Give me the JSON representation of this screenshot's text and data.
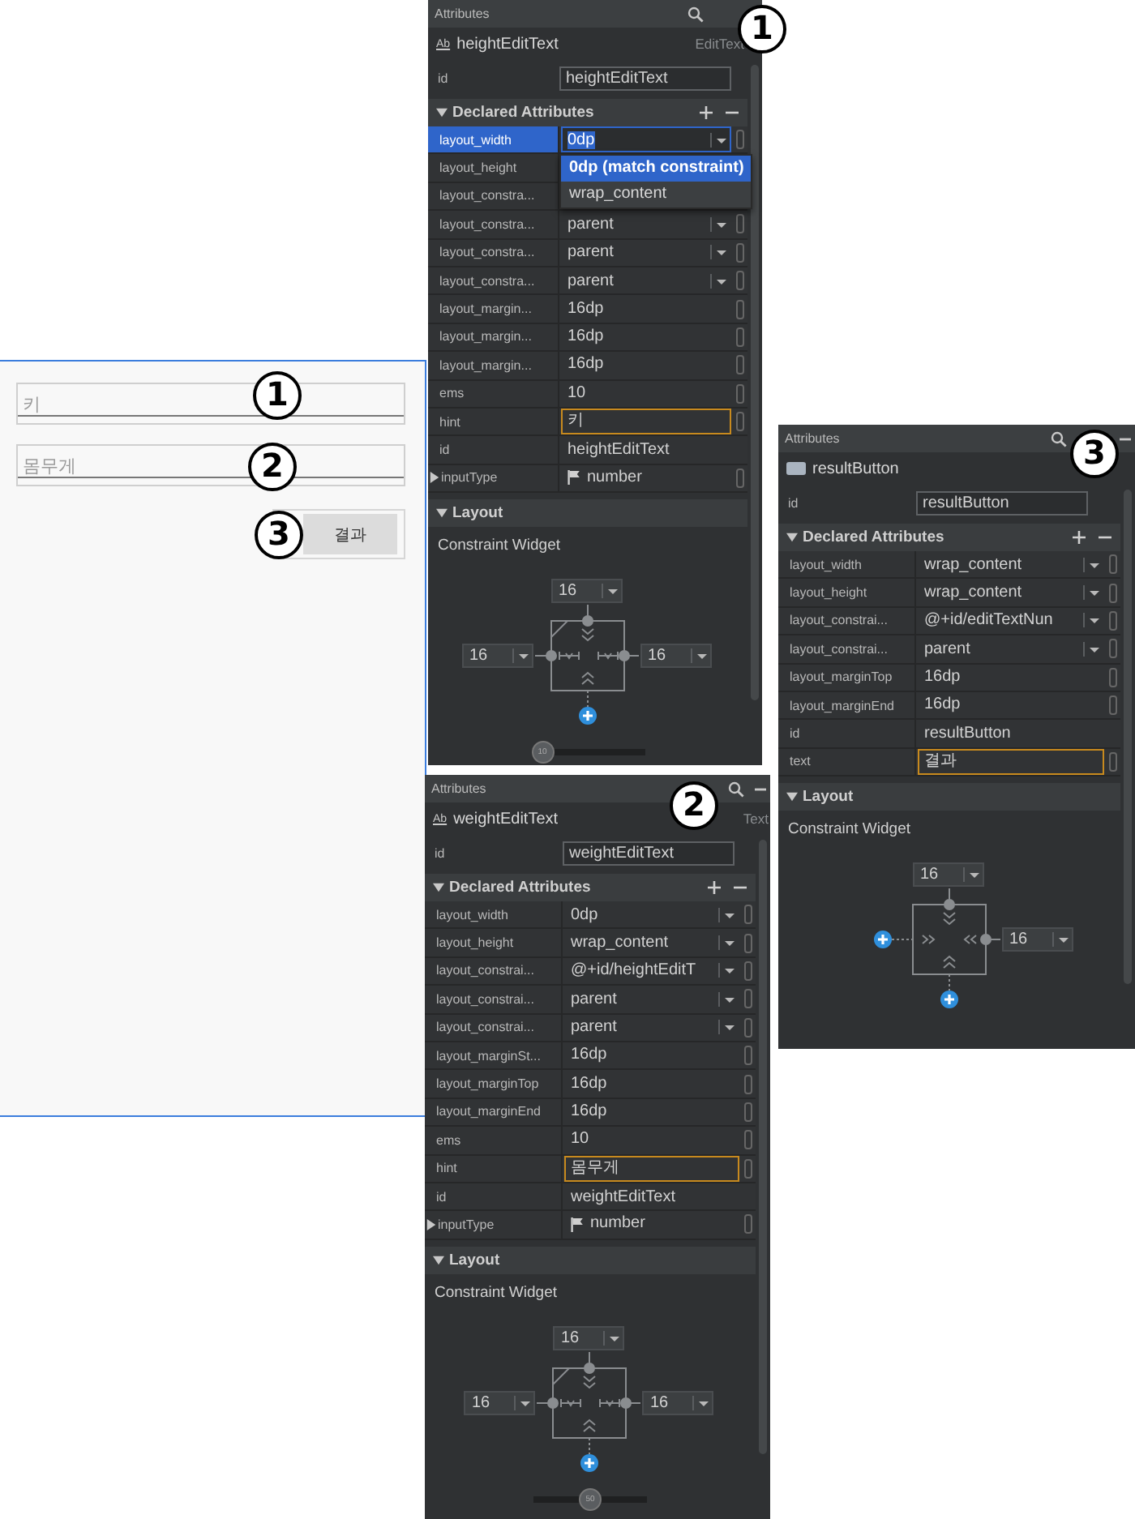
{
  "preview": {
    "fields": [
      {
        "hint": "키",
        "marker": "1"
      },
      {
        "hint": "몸무게",
        "marker": "2"
      }
    ],
    "button": {
      "label": "결과",
      "marker": "3"
    }
  },
  "panels": [
    {
      "title": "Attributes",
      "tools": [
        {
          "kind": "search"
        }
      ],
      "marker": "1",
      "component": {
        "icon": {
          "kind": "text",
          "label": "Ab"
        },
        "name": "heightEditText",
        "type": "EditText"
      },
      "id_field": {
        "label": "id",
        "value": "heightEditText"
      },
      "declared": {
        "title": "Declared Attributes",
        "expanded": true,
        "rows": [
          {
            "label": "layout_width",
            "value": "0dp",
            "kind": "dropdown",
            "selected": true,
            "options": [
              {
                "label": "0dp (match constraint)",
                "selected": true
              },
              {
                "label": "wrap_content",
                "selected": false
              }
            ]
          },
          {
            "label": "layout_height",
            "kind": "covered",
            "selected": false
          },
          {
            "label": "layout_constra...",
            "kind": "covered",
            "selected": false
          },
          {
            "label": "layout_constra...",
            "value": "parent",
            "kind": "dropdown",
            "selected": false
          },
          {
            "label": "layout_constra...",
            "value": "parent",
            "kind": "dropdown",
            "selected": false
          },
          {
            "label": "layout_constra...",
            "value": "parent",
            "kind": "dropdown",
            "selected": false
          },
          {
            "label": "layout_margin...",
            "value": "16dp",
            "kind": "text",
            "selected": false,
            "focused": false
          },
          {
            "label": "layout_margin...",
            "value": "16dp",
            "kind": "text",
            "selected": false,
            "focused": false
          },
          {
            "label": "layout_margin...",
            "value": "16dp",
            "kind": "text",
            "selected": false,
            "focused": false
          },
          {
            "label": "ems",
            "value": "10",
            "kind": "text",
            "selected": false,
            "focused": false
          },
          {
            "label": "hint",
            "value": "키",
            "kind": "text",
            "selected": false,
            "focused": true
          },
          {
            "label": "id",
            "value": "heightEditText",
            "kind": "plain",
            "selected": false
          },
          {
            "label": "inputType",
            "value": "number",
            "kind": "flag",
            "selected": false,
            "expanded": false
          }
        ]
      },
      "layout": {
        "title": "Layout",
        "expanded": true,
        "subtitle": "Constraint Widget",
        "widget": {
          "kind": "match",
          "top": {
            "kind": "value",
            "value": "16"
          },
          "left": {
            "kind": "value",
            "value": "16"
          },
          "right": {
            "kind": "value",
            "value": "16"
          },
          "bottom": {
            "kind": "add"
          }
        },
        "bias": {
          "level": 0.1,
          "label": "10"
        }
      }
    },
    {
      "title": "Attributes",
      "tools": [
        {
          "kind": "search"
        },
        {
          "kind": "minimize"
        }
      ],
      "marker": "2",
      "component": {
        "icon": {
          "kind": "text",
          "label": "Ab"
        },
        "name": "weightEditText",
        "type": "Text"
      },
      "id_field": {
        "label": "id",
        "value": "weightEditText"
      },
      "declared": {
        "title": "Declared Attributes",
        "expanded": true,
        "rows": [
          {
            "label": "layout_width",
            "value": "0dp",
            "kind": "dropdown",
            "selected": false
          },
          {
            "label": "layout_height",
            "value": "wrap_content",
            "kind": "dropdown",
            "selected": false
          },
          {
            "label": "layout_constrai...",
            "value": "@+id/heightEditT",
            "kind": "dropdown",
            "selected": false
          },
          {
            "label": "layout_constrai...",
            "value": "parent",
            "kind": "dropdown",
            "selected": false
          },
          {
            "label": "layout_constrai...",
            "value": "parent",
            "kind": "dropdown",
            "selected": false
          },
          {
            "label": "layout_marginSt...",
            "value": "16dp",
            "kind": "text",
            "selected": false,
            "focused": false
          },
          {
            "label": "layout_marginTop",
            "value": "16dp",
            "kind": "text",
            "selected": false,
            "focused": false
          },
          {
            "label": "layout_marginEnd",
            "value": "16dp",
            "kind": "text",
            "selected": false,
            "focused": false
          },
          {
            "label": "ems",
            "value": "10",
            "kind": "text",
            "selected": false,
            "focused": false
          },
          {
            "label": "hint",
            "value": "몸무게",
            "kind": "text",
            "selected": false,
            "focused": true
          },
          {
            "label": "id",
            "value": "weightEditText",
            "kind": "plain",
            "selected": false
          },
          {
            "label": "inputType",
            "value": "number",
            "kind": "flag",
            "selected": false,
            "expanded": false
          }
        ]
      },
      "layout": {
        "title": "Layout",
        "expanded": true,
        "subtitle": "Constraint Widget",
        "widget": {
          "kind": "match",
          "top": {
            "kind": "value",
            "value": "16"
          },
          "left": {
            "kind": "value",
            "value": "16"
          },
          "right": {
            "kind": "value",
            "value": "16"
          },
          "bottom": {
            "kind": "add"
          }
        },
        "bias": {
          "level": 0.5,
          "label": "50"
        }
      }
    },
    {
      "title": "Attributes",
      "tools": [
        {
          "kind": "search"
        },
        {
          "kind": "minimize"
        }
      ],
      "marker": "3",
      "component": {
        "icon": {
          "kind": "button"
        },
        "name": "resultButton"
      },
      "id_field": {
        "label": "id",
        "value": "resultButton"
      },
      "declared": {
        "title": "Declared Attributes",
        "expanded": true,
        "rows": [
          {
            "label": "layout_width",
            "value": "wrap_content",
            "kind": "dropdown",
            "selected": false
          },
          {
            "label": "layout_height",
            "value": "wrap_content",
            "kind": "dropdown",
            "selected": false
          },
          {
            "label": "layout_constrai...",
            "value": "@+id/editTextNun",
            "kind": "dropdown",
            "selected": false
          },
          {
            "label": "layout_constrai...",
            "value": "parent",
            "kind": "dropdown",
            "selected": false
          },
          {
            "label": "layout_marginTop",
            "value": "16dp",
            "kind": "text",
            "selected": false,
            "focused": false
          },
          {
            "label": "layout_marginEnd",
            "value": "16dp",
            "kind": "text",
            "selected": false,
            "focused": false
          },
          {
            "label": "id",
            "value": "resultButton",
            "kind": "plain",
            "selected": false
          },
          {
            "label": "text",
            "value": "결과",
            "kind": "text",
            "selected": false,
            "focused": true
          }
        ]
      },
      "layout": {
        "title": "Layout",
        "expanded": true,
        "subtitle": "Constraint Widget",
        "widget": {
          "kind": "wrap",
          "top": {
            "kind": "value",
            "value": "16"
          },
          "left": {
            "kind": "add"
          },
          "right": {
            "kind": "value",
            "value": "16"
          },
          "bottom": {
            "kind": "add"
          }
        }
      }
    }
  ]
}
